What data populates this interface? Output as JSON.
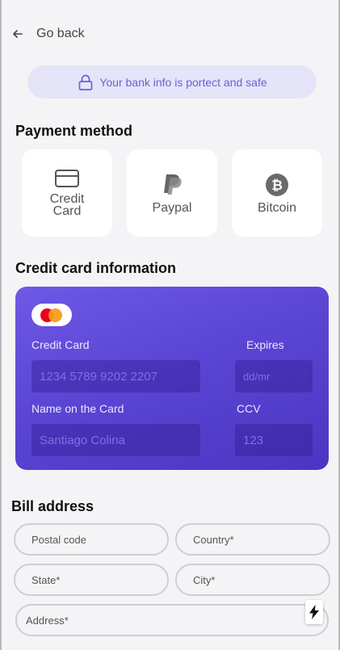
{
  "header": {
    "back_label": "Go back"
  },
  "banner": {
    "text": "Your bank info is portect and safe"
  },
  "payment": {
    "title": "Payment method",
    "methods": [
      {
        "label": "Credit\nCard",
        "icon": "credit-card-icon"
      },
      {
        "label": "Paypal",
        "icon": "paypal-icon"
      },
      {
        "label": "Bitcoin",
        "icon": "bitcoin-icon"
      }
    ]
  },
  "card_info": {
    "title": "Credit card information",
    "card_label": "Credit Card",
    "card_placeholder": "1234 5789 9202 2207",
    "expires_label": "Expires",
    "expires_placeholder": "dd/mr",
    "name_label": "Name on the Card",
    "name_placeholder": "Santiago Colina",
    "ccv_label": "CCV",
    "ccv_placeholder": "123"
  },
  "bill": {
    "title": "Bill address",
    "postal": "Postal code",
    "country": "Country*",
    "state": "State*",
    "city": "City*",
    "address": "Address*"
  },
  "colors": {
    "accent": "#6b5fd8",
    "card_gradient_start": "#6e58e6",
    "card_gradient_end": "#4b36c2"
  }
}
